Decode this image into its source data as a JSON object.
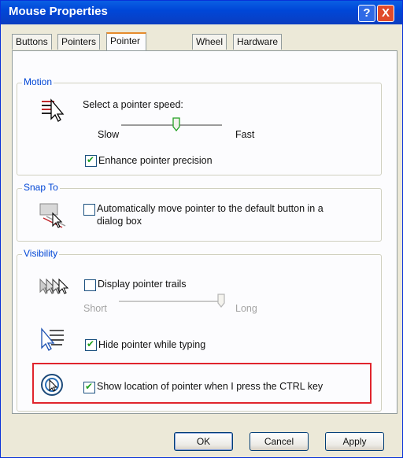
{
  "window": {
    "title": "Mouse Properties",
    "help_label": "?",
    "close_label": "X"
  },
  "tabs": [
    "Buttons",
    "Pointers",
    "Pointer Options",
    "Wheel",
    "Hardware"
  ],
  "active_tab": "Pointer Options",
  "motion": {
    "legend": "Motion",
    "speed_label": "Select a pointer speed:",
    "slow_label": "Slow",
    "fast_label": "Fast",
    "speed_level": 0.55,
    "precision_label": "Enhance pointer precision",
    "precision_checked": true
  },
  "snap_to": {
    "legend": "Snap To",
    "auto_move_label_line1": "Automatically move pointer to the default button in a",
    "auto_move_label_line2": "dialog box",
    "auto_move_checked": false
  },
  "visibility": {
    "legend": "Visibility",
    "trails_label": "Display pointer trails",
    "trails_checked": false,
    "short_label": "Short",
    "long_label": "Long",
    "trails_level": 1.0,
    "hide_typing_label": "Hide pointer while typing",
    "hide_typing_checked": true,
    "show_ctrl_label": "Show location of pointer when I press the CTRL key",
    "show_ctrl_checked": true
  },
  "highlight_color": "#e0242d",
  "buttons": {
    "ok": "OK",
    "cancel": "Cancel",
    "apply": "Apply"
  },
  "icons": [
    "pointer-speed-icon",
    "snap-to-icon",
    "pointer-trails-icon",
    "hide-pointer-icon",
    "ctrl-locate-icon"
  ]
}
